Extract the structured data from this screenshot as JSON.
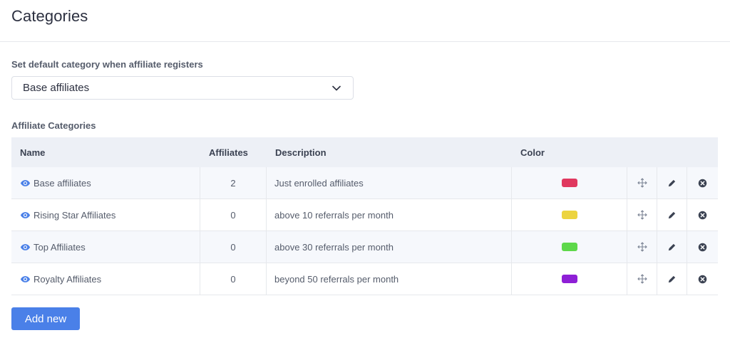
{
  "page": {
    "title": "Categories"
  },
  "default_category": {
    "label": "Set default category when affiliate registers",
    "selected": "Base affiliates",
    "icon": "chevron-down-icon"
  },
  "categories_section": {
    "label": "Affiliate Categories"
  },
  "table": {
    "headers": {
      "name": "Name",
      "affiliates": "Affiliates",
      "description": "Description",
      "color": "Color"
    },
    "rows": [
      {
        "name": "Base affiliates",
        "affiliates": "2",
        "description": "Just enrolled affiliates",
        "color": "#e0385f"
      },
      {
        "name": "Rising Star Affiliates",
        "affiliates": "0",
        "description": "above 10 referrals per month",
        "color": "#ecd43f"
      },
      {
        "name": "Top Affiliates",
        "affiliates": "0",
        "description": "above 30 referrals per month",
        "color": "#5ed84a"
      },
      {
        "name": "Royalty Affiliates",
        "affiliates": "0",
        "description": "beyond 50 referrals per month",
        "color": "#8e1fd6"
      }
    ],
    "row_icons": [
      "eye-icon",
      "move-icon",
      "pencil-icon",
      "close-circle-icon"
    ]
  },
  "actions": {
    "add_new": "Add new"
  },
  "colors": {
    "accent": "#4a80e8",
    "header_bg": "#edf0f6",
    "icon_gray": "#7b8394"
  }
}
